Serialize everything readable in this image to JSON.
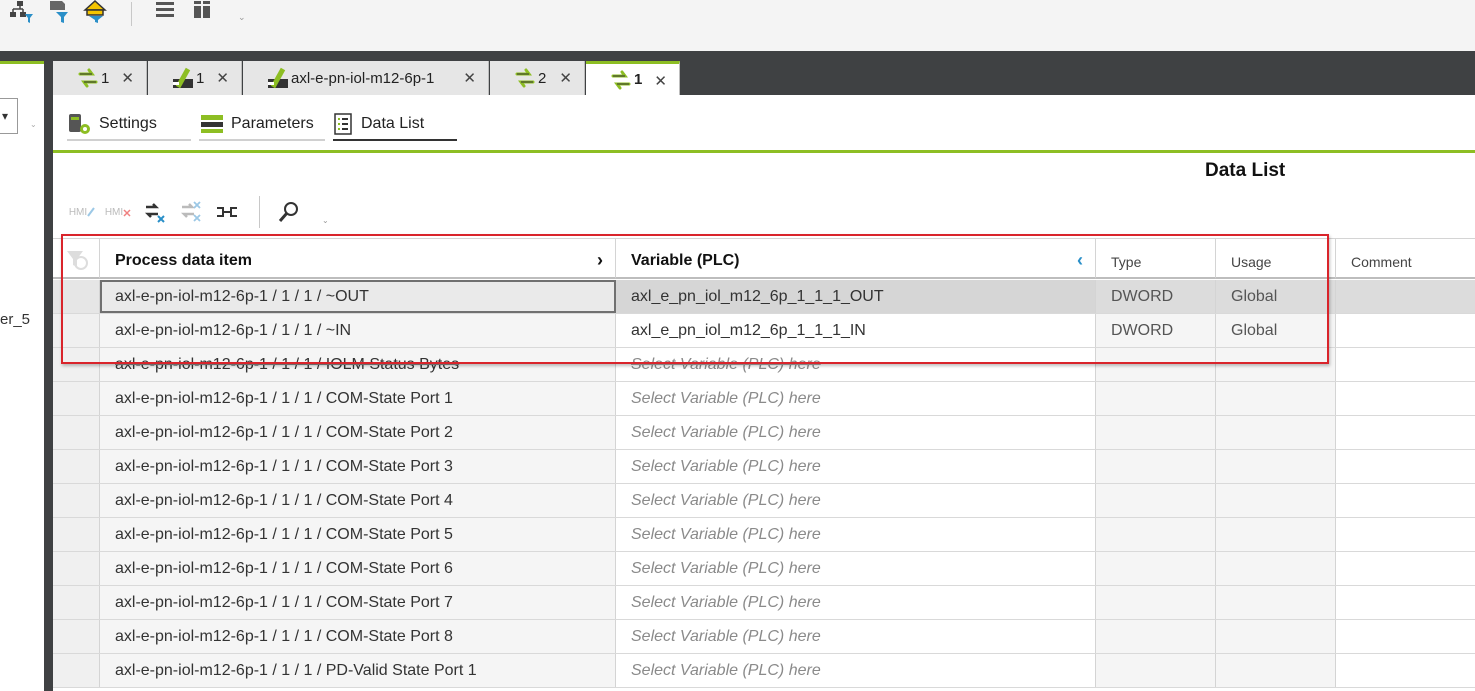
{
  "toolbar": {
    "icons": [
      "network-filter-icon",
      "device-filter-icon",
      "user-filter-icon",
      "list-view-icon",
      "column-view-icon"
    ],
    "dropdown_glyph": "⌄"
  },
  "left_panel": {
    "combo_arrow": "▾",
    "dropdown_glyph": "⌄",
    "truncated_label": "er_5"
  },
  "tabs": [
    {
      "label": "1",
      "icon": "exchange-icon",
      "close": "✕"
    },
    {
      "label": "1",
      "icon": "module-icon",
      "close": "✕"
    },
    {
      "label": "axl-e-pn-iol-m12-6p-1",
      "icon": "module-icon",
      "close": "✕"
    },
    {
      "label": "2",
      "icon": "exchange-icon",
      "close": "✕"
    },
    {
      "label": "1",
      "icon": "exchange-icon",
      "close": "✕",
      "active": true
    }
  ],
  "subtabs": [
    {
      "label": "Settings",
      "icon": "settings-icon"
    },
    {
      "label": "Parameters",
      "icon": "parameters-icon"
    },
    {
      "label": "Data List",
      "icon": "data-list-icon",
      "active": true
    }
  ],
  "panel_title": "Data List",
  "tools": {
    "hmi_add": "HMI",
    "hmi_remove": "HMI",
    "dropdown_glyph": "⌄"
  },
  "grid": {
    "columns": {
      "process_data_item": "Process data item",
      "variable_plc": "Variable (PLC)",
      "type": "Type",
      "usage": "Usage",
      "comment": "Comment"
    },
    "chevron_right": "›",
    "chevron_left": "‹",
    "rows": [
      {
        "item": "axl-e-pn-iol-m12-6p-1 / 1 / 1 / ~OUT",
        "variable": "axl_e_pn_iol_m12_6p_1_1_1_OUT",
        "type": "DWORD",
        "usage": "Global",
        "comment": ""
      },
      {
        "item": "axl-e-pn-iol-m12-6p-1 / 1 / 1 / ~IN",
        "variable": "axl_e_pn_iol_m12_6p_1_1_1_IN",
        "type": "DWORD",
        "usage": "Global",
        "comment": ""
      },
      {
        "item": "axl-e-pn-iol-m12-6p-1 / 1 / 1 / IOLM Status Bytes",
        "variable": "Select Variable (PLC) here",
        "type": "",
        "usage": "",
        "comment": ""
      },
      {
        "item": "axl-e-pn-iol-m12-6p-1 / 1 / 1 / COM-State Port 1",
        "variable": "Select Variable (PLC) here",
        "type": "",
        "usage": "",
        "comment": ""
      },
      {
        "item": "axl-e-pn-iol-m12-6p-1 / 1 / 1 / COM-State Port 2",
        "variable": "Select Variable (PLC) here",
        "type": "",
        "usage": "",
        "comment": ""
      },
      {
        "item": "axl-e-pn-iol-m12-6p-1 / 1 / 1 / COM-State Port 3",
        "variable": "Select Variable (PLC) here",
        "type": "",
        "usage": "",
        "comment": ""
      },
      {
        "item": "axl-e-pn-iol-m12-6p-1 / 1 / 1 / COM-State Port 4",
        "variable": "Select Variable (PLC) here",
        "type": "",
        "usage": "",
        "comment": ""
      },
      {
        "item": "axl-e-pn-iol-m12-6p-1 / 1 / 1 / COM-State Port 5",
        "variable": "Select Variable (PLC) here",
        "type": "",
        "usage": "",
        "comment": ""
      },
      {
        "item": "axl-e-pn-iol-m12-6p-1 / 1 / 1 / COM-State Port 6",
        "variable": "Select Variable (PLC) here",
        "type": "",
        "usage": "",
        "comment": ""
      },
      {
        "item": "axl-e-pn-iol-m12-6p-1 / 1 / 1 / COM-State Port 7",
        "variable": "Select Variable (PLC) here",
        "type": "",
        "usage": "",
        "comment": ""
      },
      {
        "item": "axl-e-pn-iol-m12-6p-1 / 1 / 1 / COM-State Port 8",
        "variable": "Select Variable (PLC) here",
        "type": "",
        "usage": "",
        "comment": ""
      },
      {
        "item": "axl-e-pn-iol-m12-6p-1 / 1 / 1 / PD-Valid State Port 1",
        "variable": "Select Variable (PLC) here",
        "type": "",
        "usage": "",
        "comment": ""
      }
    ]
  },
  "colors": {
    "accent_green": "#8dbe23",
    "frame_dark": "#3f4143",
    "highlight_red": "#d9242b"
  }
}
